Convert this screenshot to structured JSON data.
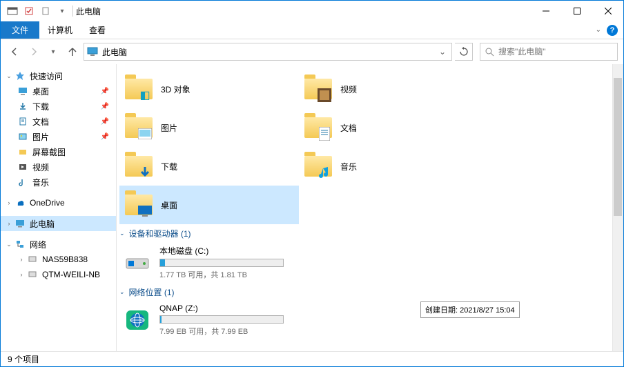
{
  "title": "此电脑",
  "ribbon": {
    "file": "文件",
    "computer": "计算机",
    "view": "查看"
  },
  "address": {
    "text": "此电脑"
  },
  "search": {
    "placeholder": "搜索\"此电脑\""
  },
  "sidebar": {
    "quick_access": "快速访问",
    "desktop": "桌面",
    "downloads": "下载",
    "documents": "文档",
    "pictures": "图片",
    "screenshots": "屏幕截图",
    "videos": "视频",
    "music": "音乐",
    "onedrive": "OneDrive",
    "this_pc": "此电脑",
    "network": "网络",
    "nas": "NAS59B838",
    "qtm": "QTM-WEILI-NB"
  },
  "folders": {
    "objects3d": "3D 对象",
    "videos": "视频",
    "pictures": "图片",
    "documents": "文档",
    "downloads": "下载",
    "music": "音乐",
    "desktop": "桌面"
  },
  "groups": {
    "devices": "设备和驱动器 (1)",
    "network": "网络位置 (1)"
  },
  "drives": {
    "c": {
      "name": "本地磁盘 (C:)",
      "stats": "1.77 TB 可用，共 1.81 TB",
      "fill_pct": 4
    },
    "z": {
      "name": "QNAP (Z:)",
      "stats": "7.99 EB 可用，共 7.99 EB",
      "fill_pct": 1
    }
  },
  "tooltip": "创建日期: 2021/8/27 15:04",
  "statusbar": "9 个项目"
}
